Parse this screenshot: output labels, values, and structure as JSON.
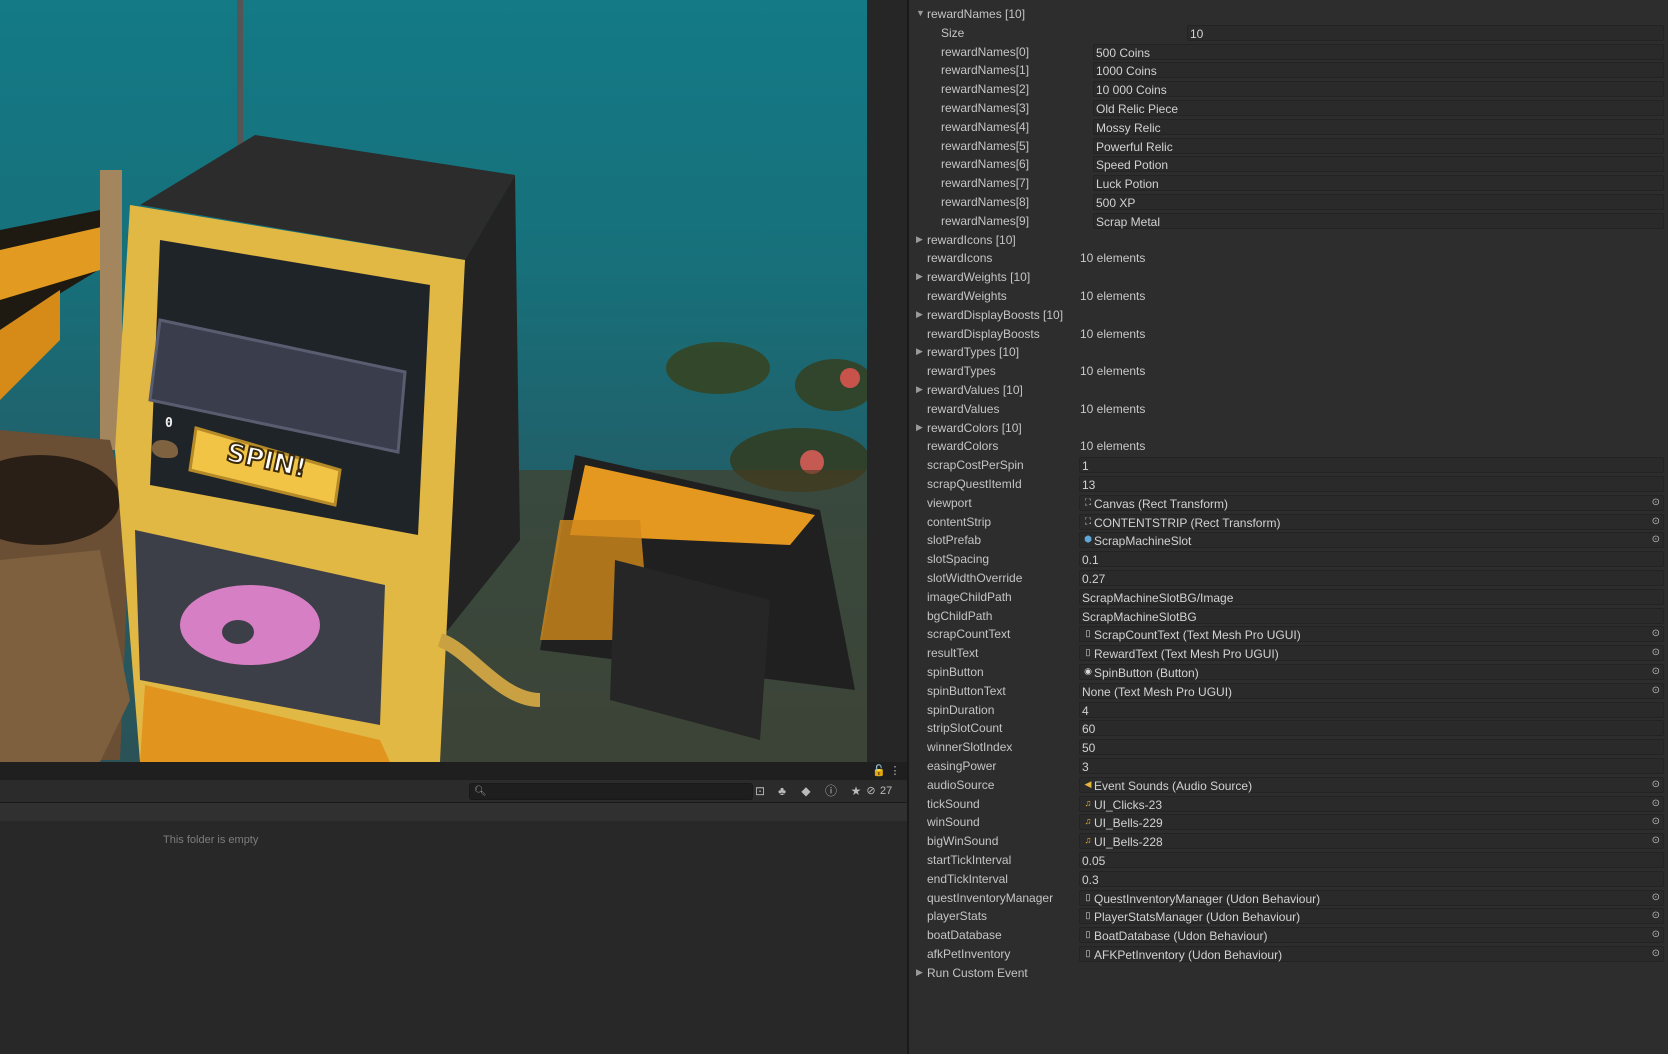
{
  "project": {
    "search_placeholder": "",
    "hidden_count": "27",
    "empty_message": "This folder is empty"
  },
  "scene": {
    "coin_count": "0",
    "spin_label": "SPIN!"
  },
  "inspector": {
    "reward_names": {
      "header": "rewardNames [10]",
      "size_label": "Size",
      "size_value": "10",
      "items": [
        {
          "label": "rewardNames[0]",
          "value": "500 Coins"
        },
        {
          "label": "rewardNames[1]",
          "value": "1000 Coins"
        },
        {
          "label": "rewardNames[2]",
          "value": "10 000 Coins"
        },
        {
          "label": "rewardNames[3]",
          "value": "Old Relic Piece"
        },
        {
          "label": "rewardNames[4]",
          "value": "Mossy Relic"
        },
        {
          "label": "rewardNames[5]",
          "value": "Powerful Relic"
        },
        {
          "label": "rewardNames[6]",
          "value": "Speed Potion"
        },
        {
          "label": "rewardNames[7]",
          "value": "Luck Potion"
        },
        {
          "label": "rewardNames[8]",
          "value": "500 XP"
        },
        {
          "label": "rewardNames[9]",
          "value": "Scrap Metal"
        }
      ]
    },
    "collapsed_arrays": [
      {
        "header": "rewardIcons [10]",
        "label": "rewardIcons",
        "value": "10 elements"
      },
      {
        "header": "rewardWeights [10]",
        "label": "rewardWeights",
        "value": "10 elements"
      },
      {
        "header": "rewardDisplayBoosts [10]",
        "label": "rewardDisplayBoosts",
        "value": "10 elements"
      },
      {
        "header": "rewardTypes [10]",
        "label": "rewardTypes",
        "value": "10 elements"
      },
      {
        "header": "rewardValues [10]",
        "label": "rewardValues",
        "value": "10 elements"
      },
      {
        "header": "rewardColors [10]",
        "label": "rewardColors",
        "value": "10 elements"
      }
    ],
    "fields": [
      {
        "label": "scrapCostPerSpin",
        "value": "1",
        "kind": "value"
      },
      {
        "label": "scrapQuestItemId",
        "value": "13",
        "kind": "value"
      },
      {
        "label": "viewport",
        "value": "Canvas (Rect Transform)",
        "kind": "ref",
        "icon": "rect-transform-icon"
      },
      {
        "label": "contentStrip",
        "value": "CONTENTSTRIP (Rect Transform)",
        "kind": "ref",
        "icon": "rect-transform-icon"
      },
      {
        "label": "slotPrefab",
        "value": "ScrapMachineSlot",
        "kind": "ref",
        "icon": "prefab-icon"
      },
      {
        "label": "slotSpacing",
        "value": "0.1",
        "kind": "value"
      },
      {
        "label": "slotWidthOverride",
        "value": "0.27",
        "kind": "value"
      },
      {
        "label": "imageChildPath",
        "value": "ScrapMachineSlotBG/Image",
        "kind": "value"
      },
      {
        "label": "bgChildPath",
        "value": "ScrapMachineSlotBG",
        "kind": "value"
      },
      {
        "label": "scrapCountText",
        "value": "ScrapCountText (Text Mesh Pro UGUI)",
        "kind": "ref",
        "icon": "script-icon"
      },
      {
        "label": "resultText",
        "value": "RewardText (Text Mesh Pro UGUI)",
        "kind": "ref",
        "icon": "script-icon"
      },
      {
        "label": "spinButton",
        "value": "SpinButton (Button)",
        "kind": "ref",
        "icon": "button-icon"
      },
      {
        "label": "spinButtonText",
        "value": "None (Text Mesh Pro UGUI)",
        "kind": "ref-none"
      },
      {
        "label": "spinDuration",
        "value": "4",
        "kind": "value"
      },
      {
        "label": "stripSlotCount",
        "value": "60",
        "kind": "value"
      },
      {
        "label": "winnerSlotIndex",
        "value": "50",
        "kind": "value"
      },
      {
        "label": "easingPower",
        "value": "3",
        "kind": "value"
      },
      {
        "label": "audioSource",
        "value": "Event Sounds (Audio Source)",
        "kind": "ref",
        "icon": "audio-source-icon"
      },
      {
        "label": "tickSound",
        "value": "UI_Clicks-23",
        "kind": "ref",
        "icon": "audio-clip-icon"
      },
      {
        "label": "winSound",
        "value": "UI_Bells-229",
        "kind": "ref",
        "icon": "audio-clip-icon"
      },
      {
        "label": "bigWinSound",
        "value": "UI_Bells-228",
        "kind": "ref",
        "icon": "audio-clip-icon"
      },
      {
        "label": "startTickInterval",
        "value": "0.05",
        "kind": "value"
      },
      {
        "label": "endTickInterval",
        "value": "0.3",
        "kind": "value"
      },
      {
        "label": "questInventoryManager",
        "value": "QuestInventoryManager (Udon Behaviour)",
        "kind": "ref",
        "icon": "script-icon"
      },
      {
        "label": "playerStats",
        "value": "PlayerStatsManager (Udon Behaviour)",
        "kind": "ref",
        "icon": "script-icon"
      },
      {
        "label": "boatDatabase",
        "value": "BoatDatabase (Udon Behaviour)",
        "kind": "ref",
        "icon": "script-icon"
      },
      {
        "label": "afkPetInventory",
        "value": "AFKPetInventory (Udon Behaviour)",
        "kind": "ref",
        "icon": "script-icon"
      }
    ],
    "custom_event_label": "Run Custom Event"
  }
}
